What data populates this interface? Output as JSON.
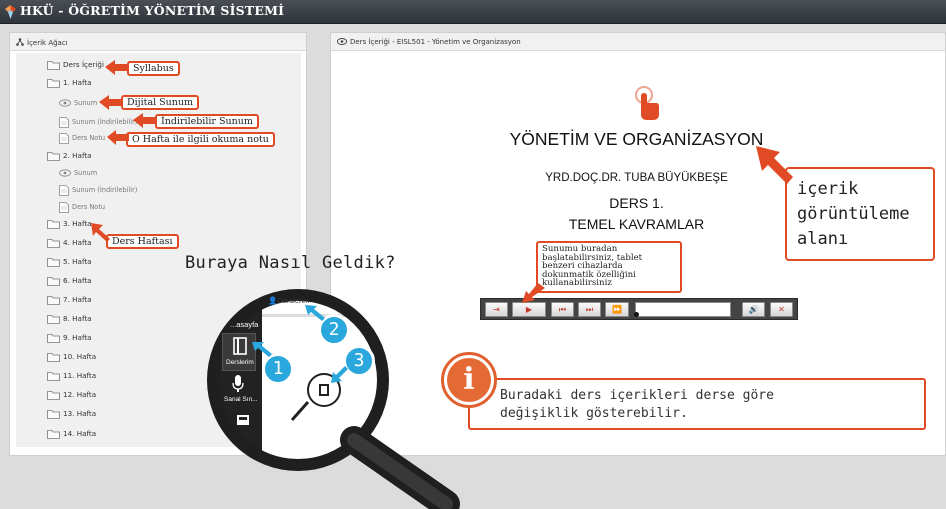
{
  "app": {
    "title": "HKÜ - ÖĞRETİM YÖNETİM SİSTEMİ"
  },
  "tree_panel": {
    "title": "İçerik Ağacı",
    "nodes": [
      {
        "label": "Ders İçeriği",
        "type": "folder"
      },
      {
        "label": "1. Hafta",
        "type": "folder"
      },
      {
        "label": "Sunum",
        "type": "eye"
      },
      {
        "label": "Sunum (İndirilebilir)",
        "type": "doc"
      },
      {
        "label": "Ders Notu",
        "type": "doc"
      },
      {
        "label": "2. Hafta",
        "type": "folder"
      },
      {
        "label": "Sunum",
        "type": "eye"
      },
      {
        "label": "Sunum (İndirilebilir)",
        "type": "doc"
      },
      {
        "label": "Ders Notu",
        "type": "doc"
      },
      {
        "label": "3. Hafta",
        "type": "folder"
      },
      {
        "label": "4. Hafta",
        "type": "folder"
      },
      {
        "label": "5. Hafta",
        "type": "folder"
      },
      {
        "label": "6. Hafta",
        "type": "folder"
      },
      {
        "label": "7. Hafta",
        "type": "folder"
      },
      {
        "label": "8. Hafta",
        "type": "folder"
      },
      {
        "label": "9. Hafta",
        "type": "folder"
      },
      {
        "label": "10. Hafta",
        "type": "folder"
      },
      {
        "label": "11. Hafta",
        "type": "folder"
      },
      {
        "label": "12. Hafta",
        "type": "folder"
      },
      {
        "label": "13. Hafta",
        "type": "folder"
      },
      {
        "label": "14. Hafta",
        "type": "folder"
      }
    ]
  },
  "content_panel": {
    "title": "Ders İçeriği - EISL501 - Yönetim ve Organizasyon"
  },
  "slide": {
    "title": "YÖNETİM VE ORGANİZASYON",
    "author": "YRD.DOÇ.DR. TUBA BÜYÜKBEŞE",
    "lesson": "DERS 1.",
    "topic": "TEMEL KAVRAMLAR"
  },
  "player": {
    "icons": [
      "exit-icon",
      "play-icon",
      "previous-icon",
      "next-icon",
      "fast-forward-icon",
      "volume-icon",
      "close-icon"
    ]
  },
  "callouts": {
    "syllabus": "Syllabus",
    "digital": "Dijital Sunum",
    "downloadable": "İndirilebilir Sunum",
    "reading": "O Hafta ile ilgili okuma notu",
    "week": "Ders Haftası",
    "view_area": "içerik\ngörüntüleme\nalanı",
    "player_tip": "Sunumu buradan\nbaşlatabilirsiniz, tablet\nbenzeri cihazlarda\ndokunmatik özelliğini\nkullanabilirsiniz",
    "info": "Buradaki ders içerikleri derse göre\ndeğişiklik gösterebilir."
  },
  "magnifier": {
    "title": "Buraya Nasıl Geldik?",
    "menu": {
      "anasayfa": "...asayfa",
      "derslerim": "Derslerim",
      "sanal": "Sanal Sın..."
    },
    "tab": "Derslerim",
    "steps": [
      "1",
      "2",
      "3"
    ]
  },
  "colors": {
    "accent": "#e04a24",
    "topbar": "#3a3f45",
    "step_blue": "#2aa7dc",
    "info_orange": "#e46a35"
  }
}
